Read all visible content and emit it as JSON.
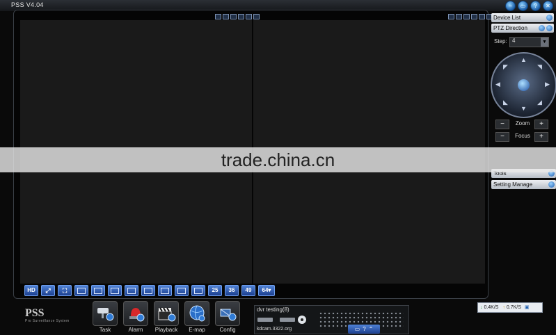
{
  "app": {
    "title": "PSS  V4.04"
  },
  "window_buttons": [
    "–",
    "▭",
    "?",
    "✕"
  ],
  "watermark": "trade.china.cn",
  "toolbar": {
    "buttons": [
      {
        "label": "HD",
        "icon": "hd-icon"
      },
      {
        "label": "",
        "icon": "fit-icon"
      },
      {
        "label": "",
        "icon": "fullscreen-icon"
      },
      {
        "label": "",
        "icon": "layout-1-icon"
      },
      {
        "label": "",
        "icon": "layout-4-icon"
      },
      {
        "label": "",
        "icon": "layout-6-icon"
      },
      {
        "label": "",
        "icon": "layout-8-icon"
      },
      {
        "label": "",
        "icon": "layout-9-icon"
      },
      {
        "label": "",
        "icon": "layout-13-icon"
      },
      {
        "label": "",
        "icon": "layout-16-icon"
      },
      {
        "label": "",
        "icon": "layout-20-icon"
      },
      {
        "label": "25",
        "icon": ""
      },
      {
        "label": "36",
        "icon": ""
      },
      {
        "label": "49",
        "icon": ""
      },
      {
        "label": "64▾",
        "icon": ""
      }
    ]
  },
  "right_panel": {
    "device_list": "Device List",
    "ptz_direction": "PTZ Direction",
    "step_label": "Step:",
    "step_value": "4",
    "zoom_label": "Zoom",
    "focus_label": "Focus",
    "tools_label": "Tools",
    "setting_manage_label": "Setting Manage"
  },
  "bottom": {
    "logo": "PSS",
    "logo_sub": "Pro Surveillance System",
    "dock": [
      {
        "label": "Task",
        "icon": "camera-icon"
      },
      {
        "label": "Alarm",
        "icon": "alarm-light-icon"
      },
      {
        "label": "Playback",
        "icon": "clapperboard-icon"
      },
      {
        "label": "E-map",
        "icon": "globe-icon"
      },
      {
        "label": "Config",
        "icon": "config-icon"
      }
    ],
    "device_name": "dvr testing(8)",
    "device_host": "kdcam.3322.org",
    "net_down": "0.4K/S",
    "net_up": "0.7K/S"
  }
}
